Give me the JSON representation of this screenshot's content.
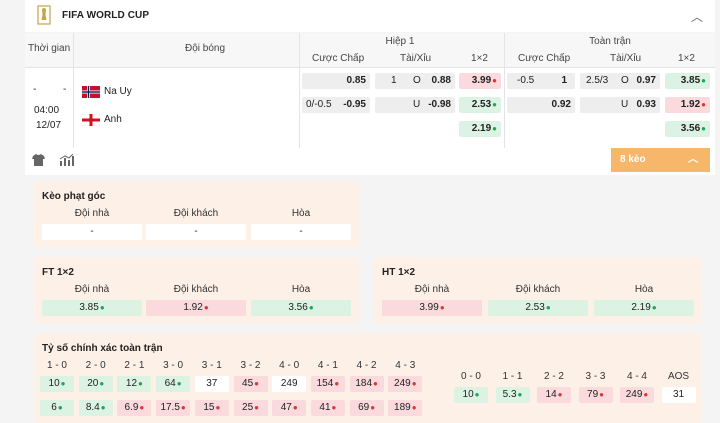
{
  "header": {
    "title": "FIFA WORLD CUP",
    "collapse_icon": "chevron-up-icon"
  },
  "table": {
    "col_time": "Thời gian",
    "col_team": "Đội bóng",
    "half1": "Hiệp 1",
    "full": "Toàn trận",
    "handicap": "Cược Chấp",
    "ou": "Tài/Xỉu",
    "x12": "1×2",
    "time_dash1": "-",
    "time_dash2": "-",
    "time": "04:00",
    "date": "12/07",
    "home": "Na Uy",
    "away": "Anh",
    "h1": {
      "hcp_r1": "0.85",
      "ou_line_r1": "1",
      "ou_side_r1": "O",
      "ou_r1": "0.88",
      "x_r1": "3.99",
      "hcp_line_r2": "0/-0.5",
      "hcp_r2": "-0.95",
      "ou_side_r2": "U",
      "ou_r2": "-0.98",
      "x_r2": "2.53",
      "x_r3": "2.19"
    },
    "ft": {
      "hcp_line_r1": "-0.5",
      "hcp_r1": "1",
      "ou_line_r1": "2.5/3",
      "ou_side_r1": "O",
      "ou_r1": "0.97",
      "x_r1": "3.85",
      "hcp_r2": "0.92",
      "ou_side_r2": "U",
      "ou_r2": "0.93",
      "x_r2": "1.92",
      "x_r3": "3.56"
    }
  },
  "bar": {
    "shirt_icon": "shirt-icon",
    "stats_icon": "bar-chart-icon",
    "more_label": "8 kèo",
    "more_icon": "chevron-up-icon"
  },
  "corner": {
    "title": "Kèo phạt góc",
    "home": "Đội nhà",
    "away": "Đội khách",
    "draw": "Hòa",
    "home_v": "-",
    "away_v": "-",
    "draw_v": "-"
  },
  "ft12": {
    "title": "FT 1×2",
    "home": "Đội nhà",
    "away": "Đội khách",
    "draw": "Hòa",
    "home_v": "3.85",
    "away_v": "1.92",
    "draw_v": "3.56"
  },
  "ht12": {
    "title": "HT 1×2",
    "home": "Đội nhà",
    "away": "Đội khách",
    "draw": "Hòa",
    "home_v": "3.99",
    "away_v": "2.53",
    "draw_v": "2.19"
  },
  "score": {
    "title": "Tỷ số chính xác toàn trận",
    "left_labels": [
      "1 - 0",
      "2 - 0",
      "2 - 1",
      "3 - 0",
      "3 - 1",
      "3 - 2",
      "4 - 0",
      "4 - 1",
      "4 - 2",
      "4 - 3"
    ],
    "left_row1": [
      "10",
      "20",
      "12",
      "64",
      "37",
      "45",
      "249",
      "154",
      "184",
      "249"
    ],
    "left_row2": [
      "6",
      "8.4",
      "6.9",
      "17.5",
      "15",
      "25",
      "47",
      "41",
      "69",
      "189"
    ],
    "right_labels": [
      "0 - 0",
      "1 - 1",
      "2 - 2",
      "3 - 3",
      "4 - 4",
      "AOS"
    ],
    "right_row1": [
      "10",
      "5.3",
      "14",
      "79",
      "249",
      "31"
    ]
  }
}
